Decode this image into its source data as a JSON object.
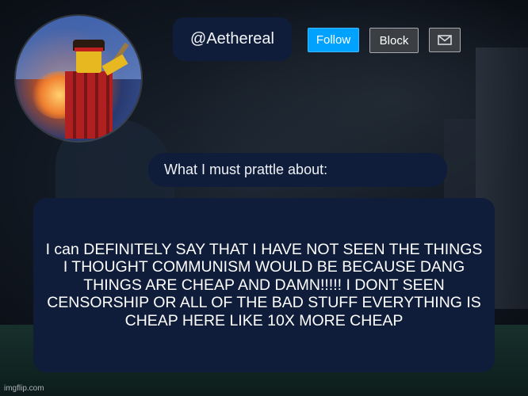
{
  "profile": {
    "username": "@Aethereal",
    "avatar_alt": "avatar"
  },
  "actions": {
    "follow_label": "Follow",
    "block_label": "Block",
    "message_icon": "mail-icon"
  },
  "about": {
    "heading": "What I must prattle about:",
    "body": "I can DEFINITELY SAY THAT I HAVE NOT SEEN THE THINGS I THOUGHT COMMUNISM WOULD BE BECAUSE DANG THINGS ARE CHEAP AND DAMN!!!!! I DONT SEEN CENSORSHIP OR ALL OF THE BAD STUFF EVERYTHING IS CHEAP HERE LIKE 10X MORE CHEAP"
  },
  "watermark": "imgflip.com",
  "colors": {
    "panel": "#0f1d3a",
    "follow": "#00a2ff",
    "button_gray": "#3b3f44"
  }
}
